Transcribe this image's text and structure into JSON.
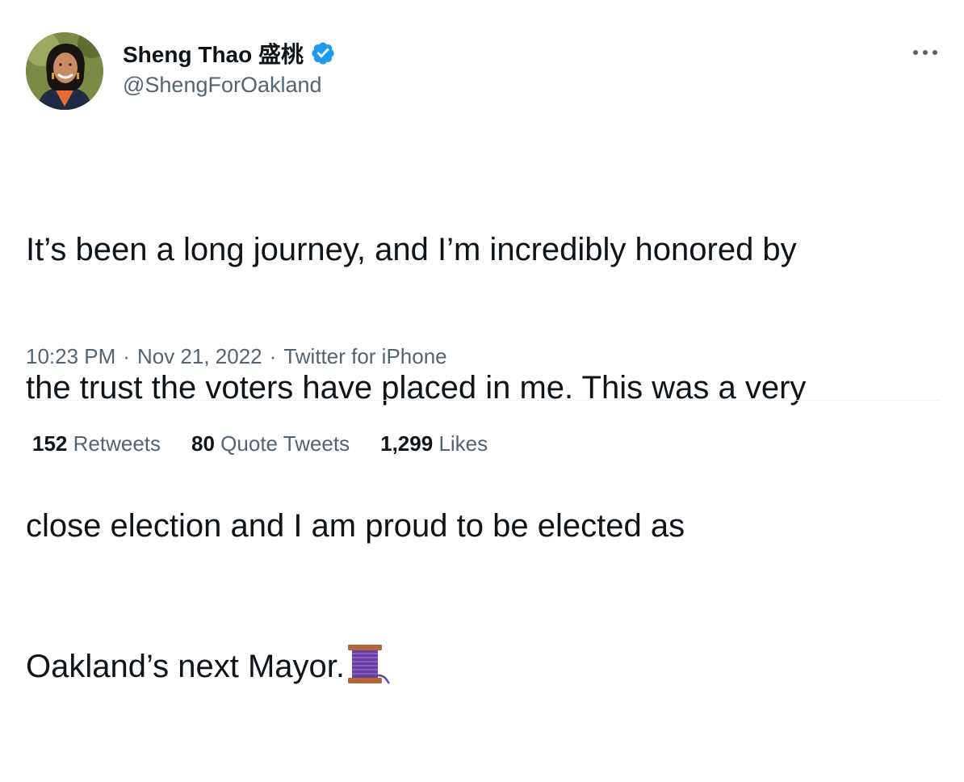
{
  "author": {
    "display_name": "Sheng Thao 盛桃",
    "handle": "@ShengForOakland",
    "verified": true,
    "avatar": "profile-photo"
  },
  "tweet": {
    "lines": [
      "It’s been a long journey, and I’m incredibly honored by",
      "the trust the voters have placed in me. This was a very",
      "close election and I am proud to be elected as",
      "Oakland’s next Mayor."
    ],
    "emoji": "spool-of-thread-icon"
  },
  "meta": {
    "time": "10:23 PM",
    "date": "Nov 21, 2022",
    "source": "Twitter for iPhone",
    "separator": "·"
  },
  "stats": {
    "retweets_count": "152",
    "retweets_label": "Retweets",
    "quotes_count": "80",
    "quotes_label": "Quote Tweets",
    "likes_count": "1,299",
    "likes_label": "Likes"
  },
  "colors": {
    "text": "#0f1419",
    "secondary": "#536471",
    "verified": "#1d9bf0",
    "divider": "#eff3f4"
  }
}
